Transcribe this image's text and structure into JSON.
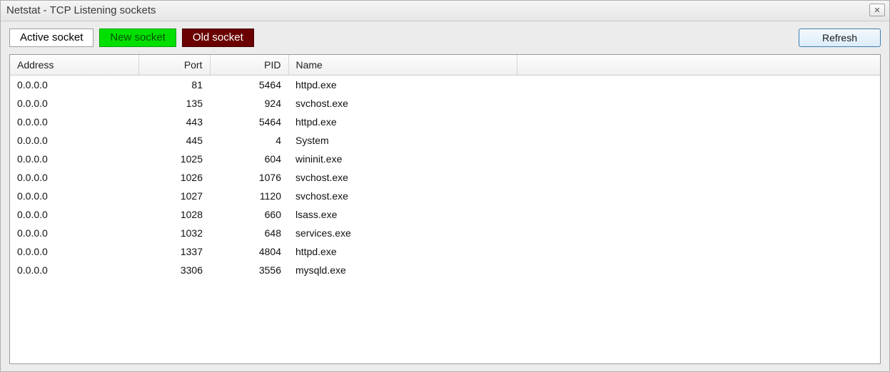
{
  "window": {
    "title": "Netstat - TCP Listening sockets"
  },
  "legend": {
    "active": "Active socket",
    "new": "New socket",
    "old": "Old socket"
  },
  "toolbar": {
    "refresh": "Refresh"
  },
  "table": {
    "columns": {
      "address": "Address",
      "port": "Port",
      "pid": "PID",
      "name": "Name"
    },
    "rows": [
      {
        "address": "0.0.0.0",
        "port": "81",
        "pid": "5464",
        "name": "httpd.exe"
      },
      {
        "address": "0.0.0.0",
        "port": "135",
        "pid": "924",
        "name": "svchost.exe"
      },
      {
        "address": "0.0.0.0",
        "port": "443",
        "pid": "5464",
        "name": "httpd.exe"
      },
      {
        "address": "0.0.0.0",
        "port": "445",
        "pid": "4",
        "name": "System"
      },
      {
        "address": "0.0.0.0",
        "port": "1025",
        "pid": "604",
        "name": "wininit.exe"
      },
      {
        "address": "0.0.0.0",
        "port": "1026",
        "pid": "1076",
        "name": "svchost.exe"
      },
      {
        "address": "0.0.0.0",
        "port": "1027",
        "pid": "1120",
        "name": "svchost.exe"
      },
      {
        "address": "0.0.0.0",
        "port": "1028",
        "pid": "660",
        "name": "lsass.exe"
      },
      {
        "address": "0.0.0.0",
        "port": "1032",
        "pid": "648",
        "name": "services.exe"
      },
      {
        "address": "0.0.0.0",
        "port": "1337",
        "pid": "4804",
        "name": "httpd.exe"
      },
      {
        "address": "0.0.0.0",
        "port": "3306",
        "pid": "3556",
        "name": "mysqld.exe"
      }
    ]
  }
}
